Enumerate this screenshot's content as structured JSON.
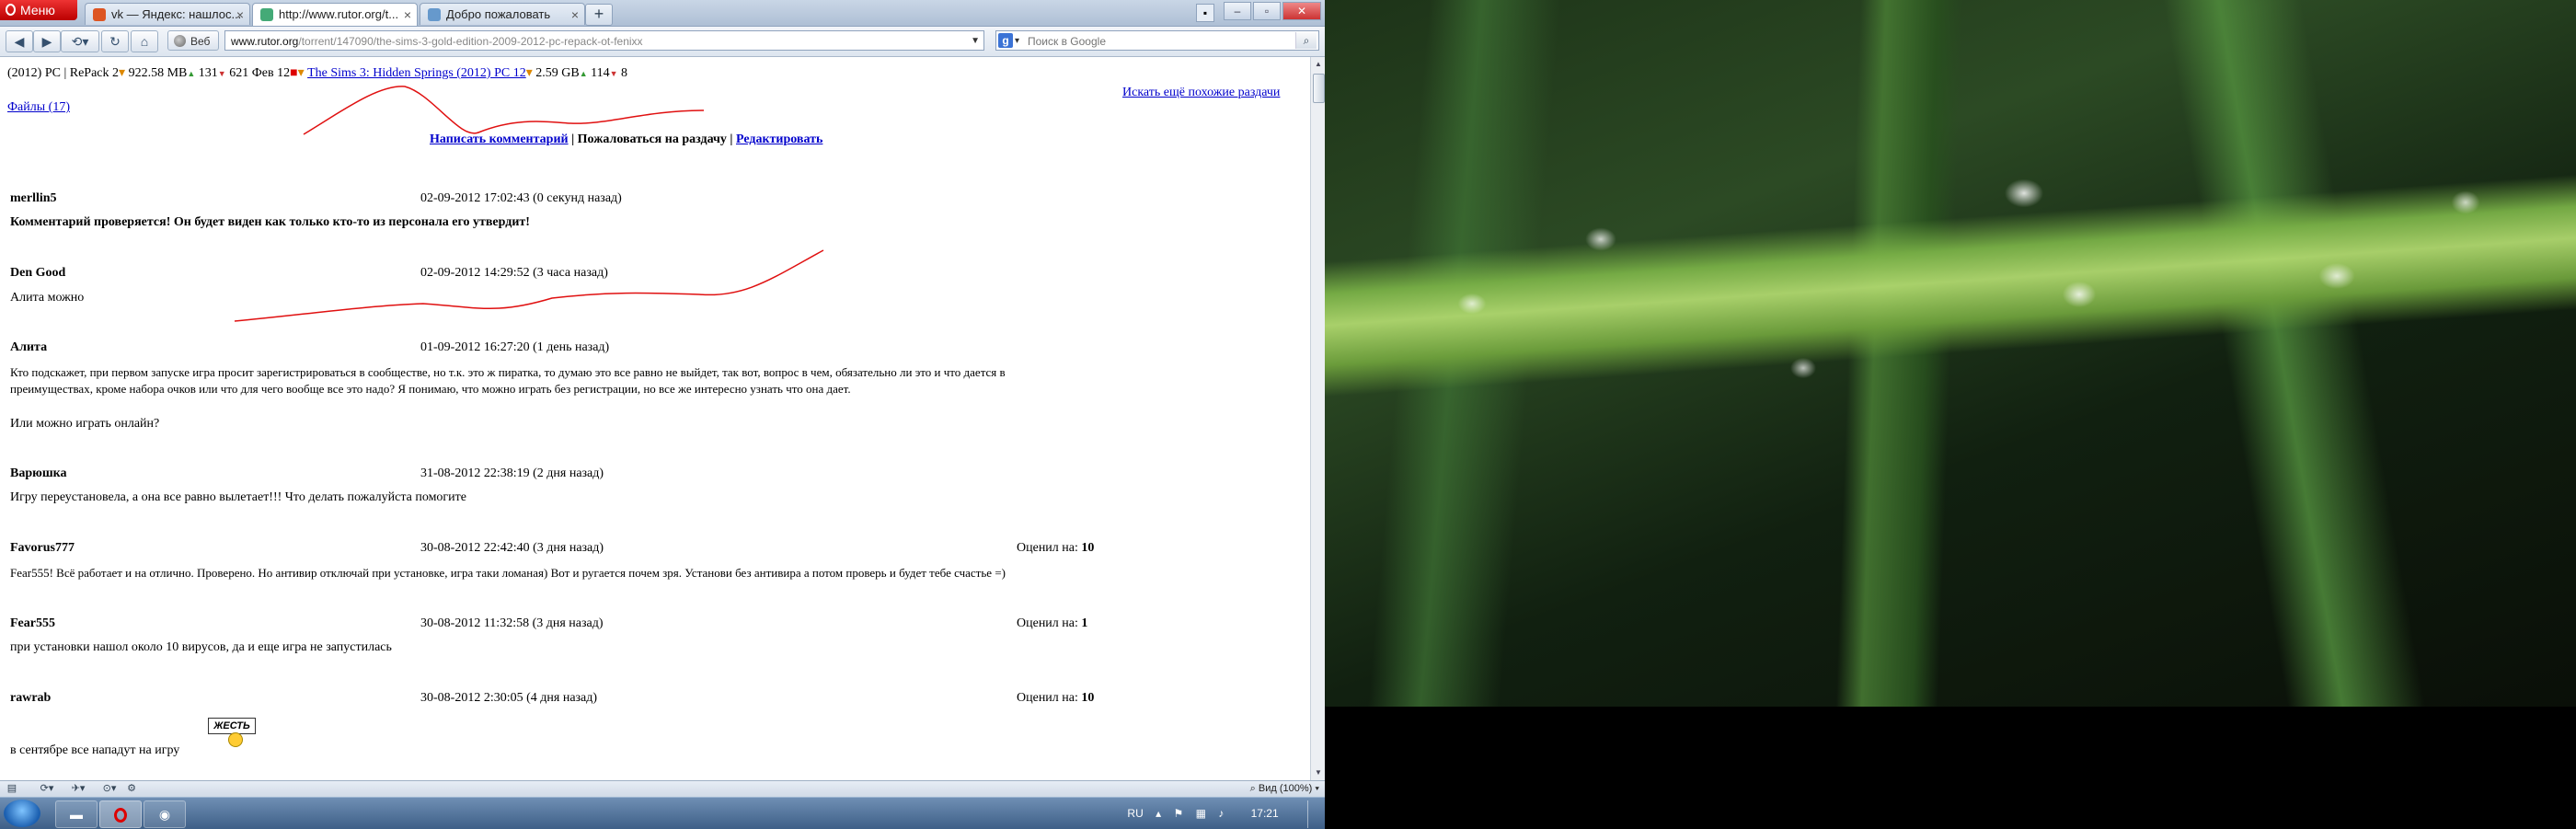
{
  "browser": {
    "menu_label": "Меню",
    "tabs": [
      {
        "label": "vk — Яндекс: нашлос...",
        "icon": "vk-favicon"
      },
      {
        "label": "http://www.rutor.org/t...",
        "icon": "rutor-favicon"
      },
      {
        "label": "Добро пожаловать",
        "icon": "page-favicon"
      }
    ],
    "tab_close": "×",
    "new_tab": "+",
    "web_label": "Веб",
    "address": {
      "domain": "www.rutor.org",
      "path": "/torrent/147090/the-sims-3-gold-edition-2009-2012-pc-repack-ot-fenixx"
    },
    "search_placeholder": "Поиск в Google",
    "zoom_label": "Вид (100%)"
  },
  "page": {
    "top_line": {
      "prefix": "(2012) PC | RePack 2",
      "rest1": "922.58 MB",
      "rest2": "131",
      "rest3": "621 Фев 12",
      "link": "The Sims 3: Hidden Springs (2012) PC 12",
      "rest4": "2.59 GB",
      "rest5": "114",
      "rest6": "8"
    },
    "files_link": "Файлы (17)",
    "similar_link": "Искать ещё похожие раздачи",
    "actions": {
      "write_comment": "Написать комментарий",
      "separator": "|",
      "complain": "Пожаловаться на раздачу",
      "edit": "Редактировать"
    },
    "comments": [
      {
        "author": "merllin5",
        "date": "02-09-2012 17:02:43 (0 секунд назад)",
        "rating_label": "",
        "rating": "",
        "lines": [
          "Комментарий проверяется! Он будет виден как только кто-то из персонала его утвердит!"
        ],
        "bold_body": true
      },
      {
        "author": "Den Good",
        "date": "02-09-2012 14:29:52 (3 часа назад)",
        "rating_label": "",
        "rating": "",
        "lines": [
          "Алита можно"
        ]
      },
      {
        "author": "Алита",
        "date": "01-09-2012 16:27:20 (1 день назад)",
        "rating_label": "",
        "rating": "",
        "lines": [
          "Кто подскажет, при первом запуске игра просит зарегистрироваться в сообществе, но т.к. это ж пиратка, то думаю это все равно не выйдет, так вот, вопрос в чем, обязательно ли это и что дается в",
          "преимуществах, кроме набора очков или что для чего вообще все это надо? Я понимаю, что можно играть без регистрации, но все же интересно узнать что она дает.",
          "",
          "Или можно играть онлайн?"
        ]
      },
      {
        "author": "Варюшка",
        "date": "31-08-2012 22:38:19 (2 дня назад)",
        "rating_label": "",
        "rating": "",
        "lines": [
          "Игру переустановела, а она все равно вылетает!!! Что делать пожалуйста помогите"
        ]
      },
      {
        "author": "Favorus777",
        "date": "30-08-2012 22:42:40 (3 дня назад)",
        "rating_label": "Оценил на:",
        "rating": "10",
        "lines": [
          "Fear555! Всё работает и на отлично. Проверено. Но антивир отключай при установке, игра таки ломаная) Вот и ругается почем зря. Установи без антивира а потом проверь и будет тебе счастье =)"
        ]
      },
      {
        "author": "Fear555",
        "date": "30-08-2012 11:32:58 (3 дня назад)",
        "rating_label": "Оценил на:",
        "rating": "1",
        "lines": [
          "при установки нашол около 10 вирусов, да и еще игра не запустилась"
        ]
      },
      {
        "author": "rawrab",
        "date": "30-08-2012 2:30:05 (4 дня назад)",
        "rating_label": "Оценил на:",
        "rating": "10",
        "lines": [
          "в сентябре все нападут на игру"
        ],
        "sticker": "ЖЕСТЬ"
      }
    ]
  },
  "taskbar": {
    "lang": "RU",
    "clock": "17:21"
  },
  "colors": {
    "link": "#0000cc",
    "annotation": "#e01010"
  }
}
